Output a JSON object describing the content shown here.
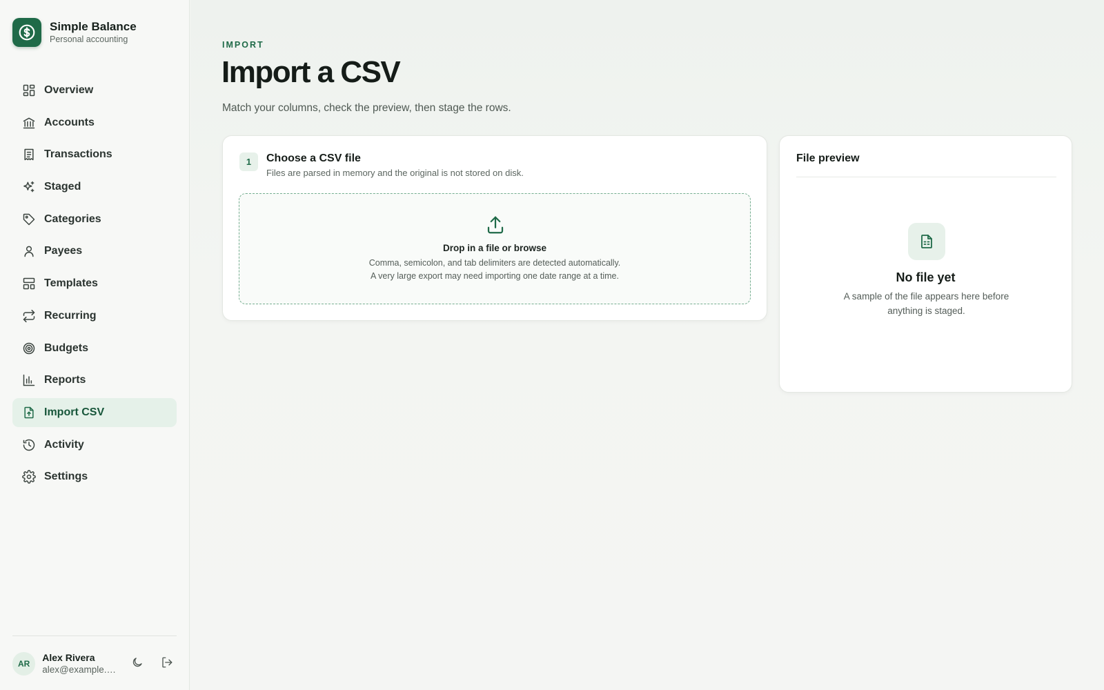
{
  "brand": {
    "name": "Simple Balance",
    "subtitle": "Personal accounting",
    "icon": "dollar-circle-icon"
  },
  "nav": {
    "items": [
      {
        "label": "Overview",
        "icon": "grid-icon"
      },
      {
        "label": "Accounts",
        "icon": "bank-icon"
      },
      {
        "label": "Transactions",
        "icon": "receipt-icon"
      },
      {
        "label": "Staged",
        "icon": "sparkles-icon"
      },
      {
        "label": "Categories",
        "icon": "tag-icon"
      },
      {
        "label": "Payees",
        "icon": "user-icon"
      },
      {
        "label": "Templates",
        "icon": "layout-icon"
      },
      {
        "label": "Recurring",
        "icon": "repeat-icon"
      },
      {
        "label": "Budgets",
        "icon": "target-icon"
      },
      {
        "label": "Reports",
        "icon": "bar-chart-icon"
      },
      {
        "label": "Import CSV",
        "icon": "file-upload-icon",
        "active": true
      },
      {
        "label": "Activity",
        "icon": "history-icon"
      },
      {
        "label": "Settings",
        "icon": "gear-icon"
      }
    ]
  },
  "user": {
    "initials": "AR",
    "name": "Alex Rivera",
    "email": "alex@example.com"
  },
  "page": {
    "eyebrow": "IMPORT",
    "title": "Import a CSV",
    "subtitle": "Match your columns, check the preview, then stage the rows."
  },
  "choose": {
    "step": "1",
    "title": "Choose a CSV file",
    "subtitle": "Files are parsed in memory and the original is not stored on disk.",
    "dropzone": {
      "title": "Drop in a file or browse",
      "line1": "Comma, semicolon, and tab delimiters are detected automatically.",
      "line2": "A very large export may need importing one date range at a time."
    }
  },
  "preview": {
    "title": "File preview",
    "empty_title": "No file yet",
    "empty_text": "A sample of the file appears here before anything is staged."
  },
  "colors": {
    "accent": "#1f6a48",
    "active_bg": "#e5f1e9",
    "sidebar_bg": "#f7f8f6"
  }
}
